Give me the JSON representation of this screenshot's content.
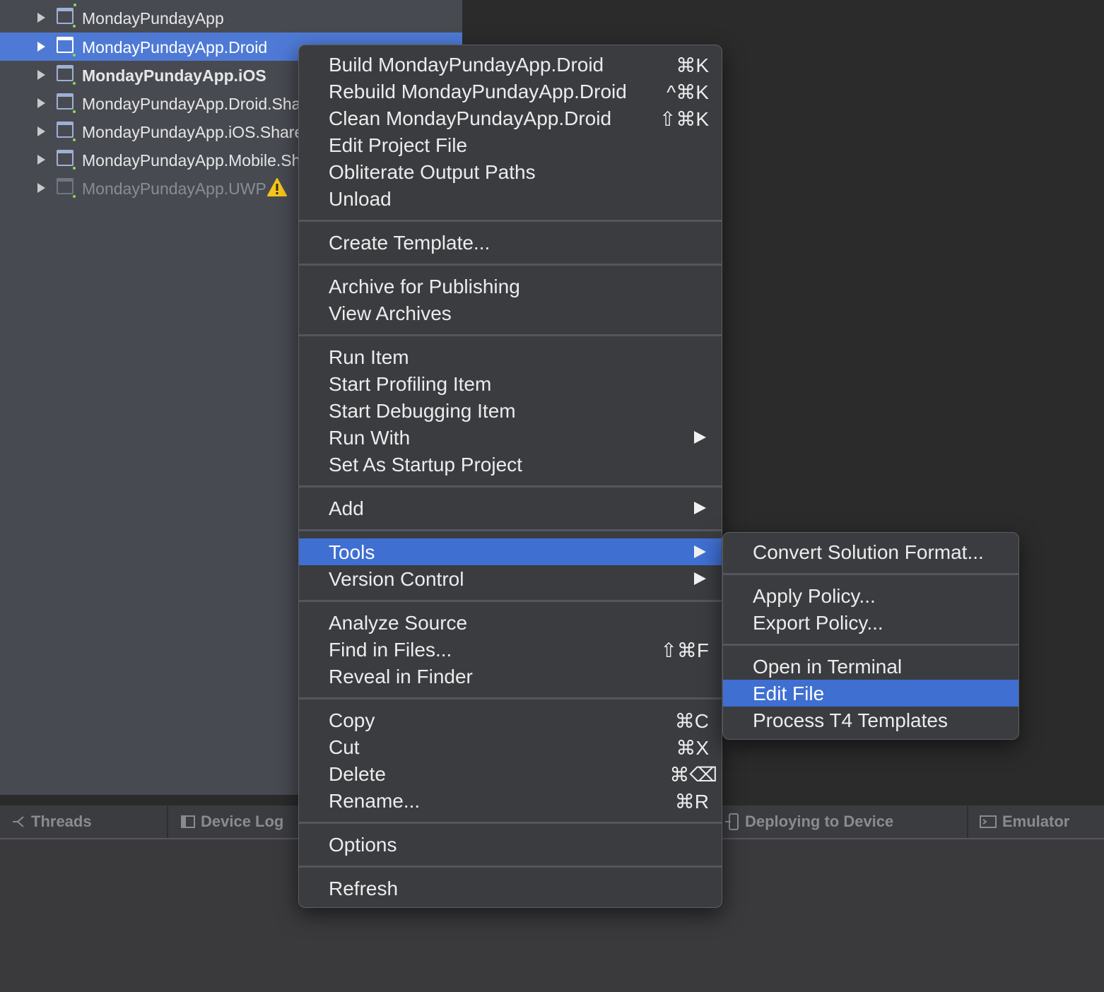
{
  "solution_tree": {
    "items": [
      {
        "label": "MondayPundayApp"
      },
      {
        "label": "MondayPundayApp.Droid"
      },
      {
        "label": "MondayPundayApp.iOS"
      },
      {
        "label": "MondayPundayApp.Droid.Shar"
      },
      {
        "label": "MondayPundayApp.iOS.Sharec"
      },
      {
        "label": "MondayPundayApp.Mobile.Sha"
      },
      {
        "label": "MondayPundayApp.UWP",
        "status": "warning-icon"
      }
    ]
  },
  "pad_tabs": [
    {
      "label": "Threads",
      "icon": "threads-icon"
    },
    {
      "label": "Device Log",
      "icon": "device-log-icon"
    },
    {
      "label": "Deploying to Device",
      "icon": "device-icon"
    },
    {
      "label": "Emulator",
      "icon": "emulator-icon"
    }
  ],
  "context_menu": {
    "groups": [
      [
        {
          "label": "Build MondayPundayApp.Droid",
          "shortcut": "⌘K"
        },
        {
          "label": "Rebuild MondayPundayApp.Droid",
          "shortcut": "^⌘K"
        },
        {
          "label": "Clean MondayPundayApp.Droid",
          "shortcut": "⇧⌘K"
        },
        {
          "label": "Edit Project File"
        },
        {
          "label": "Obliterate Output Paths"
        },
        {
          "label": "Unload"
        }
      ],
      [
        {
          "label": "Create Template..."
        }
      ],
      [
        {
          "label": "Archive for Publishing"
        },
        {
          "label": "View Archives"
        }
      ],
      [
        {
          "label": "Run Item"
        },
        {
          "label": "Start Profiling Item"
        },
        {
          "label": "Start Debugging Item"
        },
        {
          "label": "Run With",
          "submenu": true
        },
        {
          "label": "Set As Startup Project"
        }
      ],
      [
        {
          "label": "Add",
          "submenu": true
        }
      ],
      [
        {
          "label": "Tools",
          "submenu": true,
          "highlighted": true
        },
        {
          "label": "Version Control",
          "submenu": true
        }
      ],
      [
        {
          "label": "Analyze Source"
        },
        {
          "label": "Find in Files...",
          "shortcut": "⇧⌘F"
        },
        {
          "label": "Reveal in Finder"
        }
      ],
      [
        {
          "label": "Copy",
          "shortcut": "⌘C"
        },
        {
          "label": "Cut",
          "shortcut": "⌘X"
        },
        {
          "label": "Delete",
          "shortcut": "⌘⌫"
        },
        {
          "label": "Rename...",
          "shortcut": "⌘R"
        }
      ],
      [
        {
          "label": "Options"
        }
      ],
      [
        {
          "label": "Refresh"
        }
      ]
    ]
  },
  "tools_submenu": {
    "groups": [
      [
        {
          "label": "Convert Solution Format..."
        }
      ],
      [
        {
          "label": "Apply Policy..."
        },
        {
          "label": "Export Policy..."
        }
      ],
      [
        {
          "label": "Open in Terminal"
        },
        {
          "label": "Edit File",
          "highlighted": true
        },
        {
          "label": "Process T4 Templates"
        }
      ]
    ]
  },
  "colors": {
    "selection": "#4e7ad6",
    "menu_highlight": "#3f6fd1",
    "menu_background": "#3b3c40",
    "pad_background": "#484a52"
  }
}
